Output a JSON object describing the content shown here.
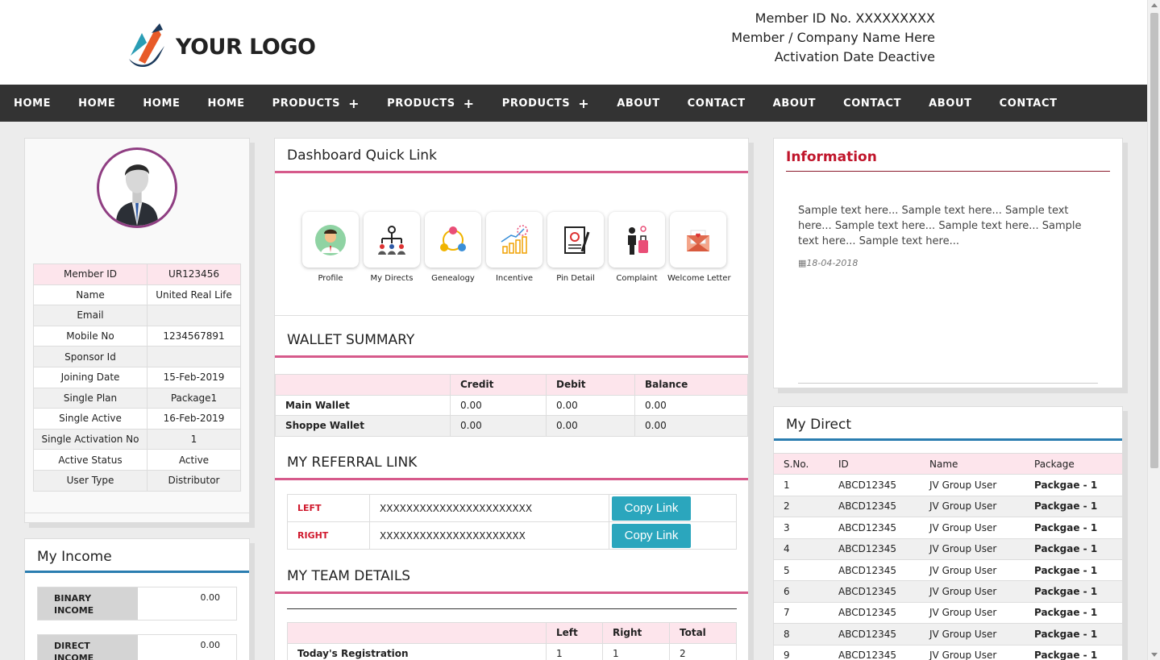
{
  "header": {
    "logo_text": "YOUR LOGO",
    "member_id_line": "Member ID No. XXXXXXXXX",
    "member_name_line": "Member / Company Name Here",
    "activation_line": "Activation Date Deactive"
  },
  "nav": {
    "items": [
      {
        "label": "HOME"
      },
      {
        "label": "HOME"
      },
      {
        "label": "HOME"
      },
      {
        "label": "HOME"
      },
      {
        "label": "PRODUCTS",
        "plus": "+"
      },
      {
        "label": "PRODUCTS",
        "plus": "+"
      },
      {
        "label": "PRODUCTS",
        "plus": "+"
      },
      {
        "label": "ABOUT"
      },
      {
        "label": "CONTACT"
      },
      {
        "label": "ABOUT"
      },
      {
        "label": "CONTACT"
      },
      {
        "label": "ABOUT"
      },
      {
        "label": "CONTACT"
      }
    ]
  },
  "profile": {
    "rows": [
      {
        "label": "Member ID",
        "value": "UR123456"
      },
      {
        "label": "Name",
        "value": "United Real Life"
      },
      {
        "label": "Email",
        "value": ""
      },
      {
        "label": "Mobile No",
        "value": "1234567891"
      },
      {
        "label": "Sponsor Id",
        "value": ""
      },
      {
        "label": "Joining Date",
        "value": "15-Feb-2019"
      },
      {
        "label": "Single Plan",
        "value": "Package1"
      },
      {
        "label": "Single Active",
        "value": "16-Feb-2019"
      },
      {
        "label": "Single Activation No",
        "value": "1"
      },
      {
        "label": "Active Status",
        "value": "Active"
      },
      {
        "label": "User Type",
        "value": "Distributor"
      }
    ]
  },
  "income": {
    "title": "My Income",
    "rows": [
      {
        "label_line1": "BINARY",
        "label_line2": "INCOME",
        "value": "0.00"
      },
      {
        "label_line1": "DIRECT",
        "label_line2": "INCOME",
        "value": "0.00"
      }
    ]
  },
  "quick_links": {
    "title": "Dashboard Quick Link",
    "tiles": [
      {
        "label": "Profile",
        "icon": "profile-icon"
      },
      {
        "label": "My Directs",
        "icon": "my-directs-icon"
      },
      {
        "label": "Genealogy",
        "icon": "genealogy-icon"
      },
      {
        "label": "Incentive",
        "icon": "incentive-icon"
      },
      {
        "label": "Pin Detail",
        "icon": "pin-detail-icon"
      },
      {
        "label": "Complaint",
        "icon": "complaint-icon"
      },
      {
        "label": "Welcome Letter",
        "icon": "welcome-letter-icon"
      }
    ]
  },
  "wallet": {
    "title": "WALLET SUMMARY",
    "headers": [
      "",
      "Credit",
      "Debit",
      "Balance"
    ],
    "rows": [
      {
        "name": "Main Wallet",
        "credit": "0.00",
        "debit": "0.00",
        "balance": "0.00"
      },
      {
        "name": "Shoppe Wallet",
        "credit": "0.00",
        "debit": "0.00",
        "balance": "0.00"
      }
    ]
  },
  "referral": {
    "title": "MY REFERRAL LINK",
    "rows": [
      {
        "side": "LEFT",
        "link": "XXXXXXXXXXXXXXXXXXXXXXX",
        "button": "Copy Link"
      },
      {
        "side": "RIGHT",
        "link": "XXXXXXXXXXXXXXXXXXXXXX",
        "button": "Copy Link"
      }
    ]
  },
  "team": {
    "title": "MY TEAM DETAILS",
    "headers": [
      "",
      "Left",
      "Right",
      "Total"
    ],
    "rows": [
      {
        "name": "Today's Registration",
        "left": "1",
        "right": "1",
        "total": "2"
      }
    ]
  },
  "information": {
    "title": "Information",
    "text": "Sample text here... Sample text here... Sample text here... Sample text here... Sample text here... Sample text here... Sample text here...",
    "date": "18-04-2018"
  },
  "direct": {
    "title": "My Direct",
    "headers": [
      "S.No.",
      "ID",
      "Name",
      "Package"
    ],
    "rows": [
      {
        "sno": "1",
        "id": "ABCD12345",
        "name": "JV Group User",
        "package": "Packgae - 1"
      },
      {
        "sno": "2",
        "id": "ABCD12345",
        "name": "JV Group User",
        "package": "Packgae - 1"
      },
      {
        "sno": "3",
        "id": "ABCD12345",
        "name": "JV Group User",
        "package": "Packgae - 1"
      },
      {
        "sno": "4",
        "id": "ABCD12345",
        "name": "JV Group User",
        "package": "Packgae - 1"
      },
      {
        "sno": "5",
        "id": "ABCD12345",
        "name": "JV Group User",
        "package": "Packgae - 1"
      },
      {
        "sno": "6",
        "id": "ABCD12345",
        "name": "JV Group User",
        "package": "Packgae - 1"
      },
      {
        "sno": "7",
        "id": "ABCD12345",
        "name": "JV Group User",
        "package": "Packgae - 1"
      },
      {
        "sno": "8",
        "id": "ABCD12345",
        "name": "JV Group User",
        "package": "Packgae - 1"
      },
      {
        "sno": "9",
        "id": "ABCD12345",
        "name": "JV Group User",
        "package": "Packgae - 1"
      }
    ]
  },
  "colors": {
    "nav_bg": "#333333",
    "pink_accent": "#d65a8b",
    "blue_accent": "#2a7db0",
    "red_title": "#c0152b",
    "copy_button": "#2ba6bd",
    "avatar_ring": "#8f3e82"
  }
}
